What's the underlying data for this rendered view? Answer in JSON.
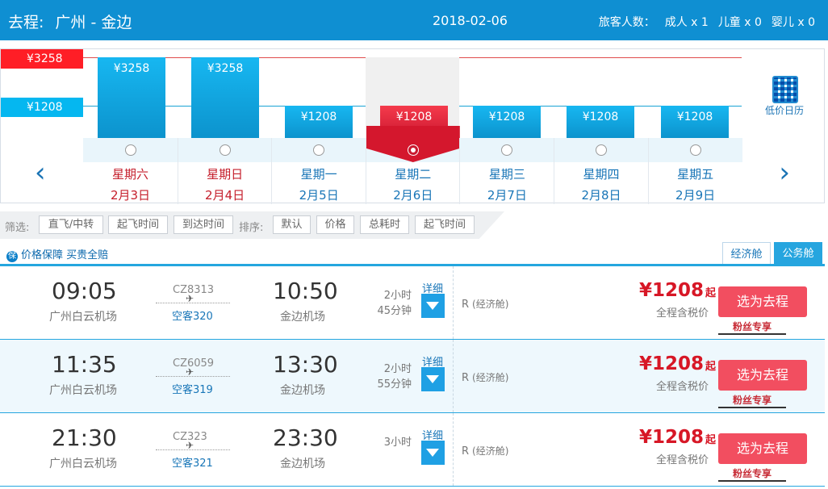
{
  "header": {
    "trip_type": "去程:",
    "route": "广州 - 金边",
    "date": "2018-02-06",
    "passengers_label": "旅客人数：",
    "adult": "成人 x 1",
    "child": "儿童 x 0",
    "infant": "婴儿 x 0"
  },
  "calendar": {
    "high_label": "¥3258",
    "low_label": "¥1208",
    "calendar_button": "低价日历",
    "days": [
      {
        "price": "¥3258",
        "value": 3258,
        "weekday": "星期六",
        "date": "2月3日",
        "weekend": true,
        "selected": false
      },
      {
        "price": "¥3258",
        "value": 3258,
        "weekday": "星期日",
        "date": "2月4日",
        "weekend": true,
        "selected": false
      },
      {
        "price": "¥1208",
        "value": 1208,
        "weekday": "星期一",
        "date": "2月5日",
        "weekend": false,
        "selected": false
      },
      {
        "price": "¥1208",
        "value": 1208,
        "weekday": "星期二",
        "date": "2月6日",
        "weekend": false,
        "selected": true
      },
      {
        "price": "¥1208",
        "value": 1208,
        "weekday": "星期三",
        "date": "2月7日",
        "weekend": false,
        "selected": false
      },
      {
        "price": "¥1208",
        "value": 1208,
        "weekday": "星期四",
        "date": "2月8日",
        "weekend": false,
        "selected": false
      },
      {
        "price": "¥1208",
        "value": 1208,
        "weekday": "星期五",
        "date": "2月9日",
        "weekend": false,
        "selected": false
      }
    ]
  },
  "filters": {
    "filter_label": "筛选:",
    "filter_buttons": [
      "直飞/中转",
      "起飞时间",
      "到达时间"
    ],
    "sort_label": "排序:",
    "sort_buttons": [
      "默认",
      "价格",
      "总耗时",
      "起飞时间"
    ]
  },
  "banner": {
    "guarantee": "价格保障 买贵全赔",
    "badge": "保"
  },
  "tabs": {
    "economy": "经济舱",
    "business": "公务舱"
  },
  "flights": [
    {
      "depart_time": "09:05",
      "depart_airport": "广州白云机场",
      "flight_no": "CZ8313",
      "aircraft": "空客320",
      "arrive_time": "10:50",
      "arrive_airport": "金边机场",
      "duration_1": "2小时",
      "duration_2": "45分钟",
      "detail_label": "详细",
      "cabin_letter": "R",
      "cabin_name": "(经济舱)",
      "price": "¥1208",
      "price_suffix": "起",
      "tax_note": "全程含税价",
      "select_label": "选为去程",
      "fan_label": "粉丝专享"
    },
    {
      "depart_time": "11:35",
      "depart_airport": "广州白云机场",
      "flight_no": "CZ6059",
      "aircraft": "空客319",
      "arrive_time": "13:30",
      "arrive_airport": "金边机场",
      "duration_1": "2小时",
      "duration_2": "55分钟",
      "detail_label": "详细",
      "cabin_letter": "R",
      "cabin_name": "(经济舱)",
      "price": "¥1208",
      "price_suffix": "起",
      "tax_note": "全程含税价",
      "select_label": "选为去程",
      "fan_label": "粉丝专享"
    },
    {
      "depart_time": "21:30",
      "depart_airport": "广州白云机场",
      "flight_no": "CZ323",
      "aircraft": "空客321",
      "arrive_time": "23:30",
      "arrive_airport": "金边机场",
      "duration_1": "3小时",
      "duration_2": "",
      "detail_label": "详细",
      "cabin_letter": "R",
      "cabin_name": "(经济舱)",
      "price": "¥1208",
      "price_suffix": "起",
      "tax_note": "全程含税价",
      "select_label": "选为去程",
      "fan_label": "粉丝专享"
    }
  ]
}
